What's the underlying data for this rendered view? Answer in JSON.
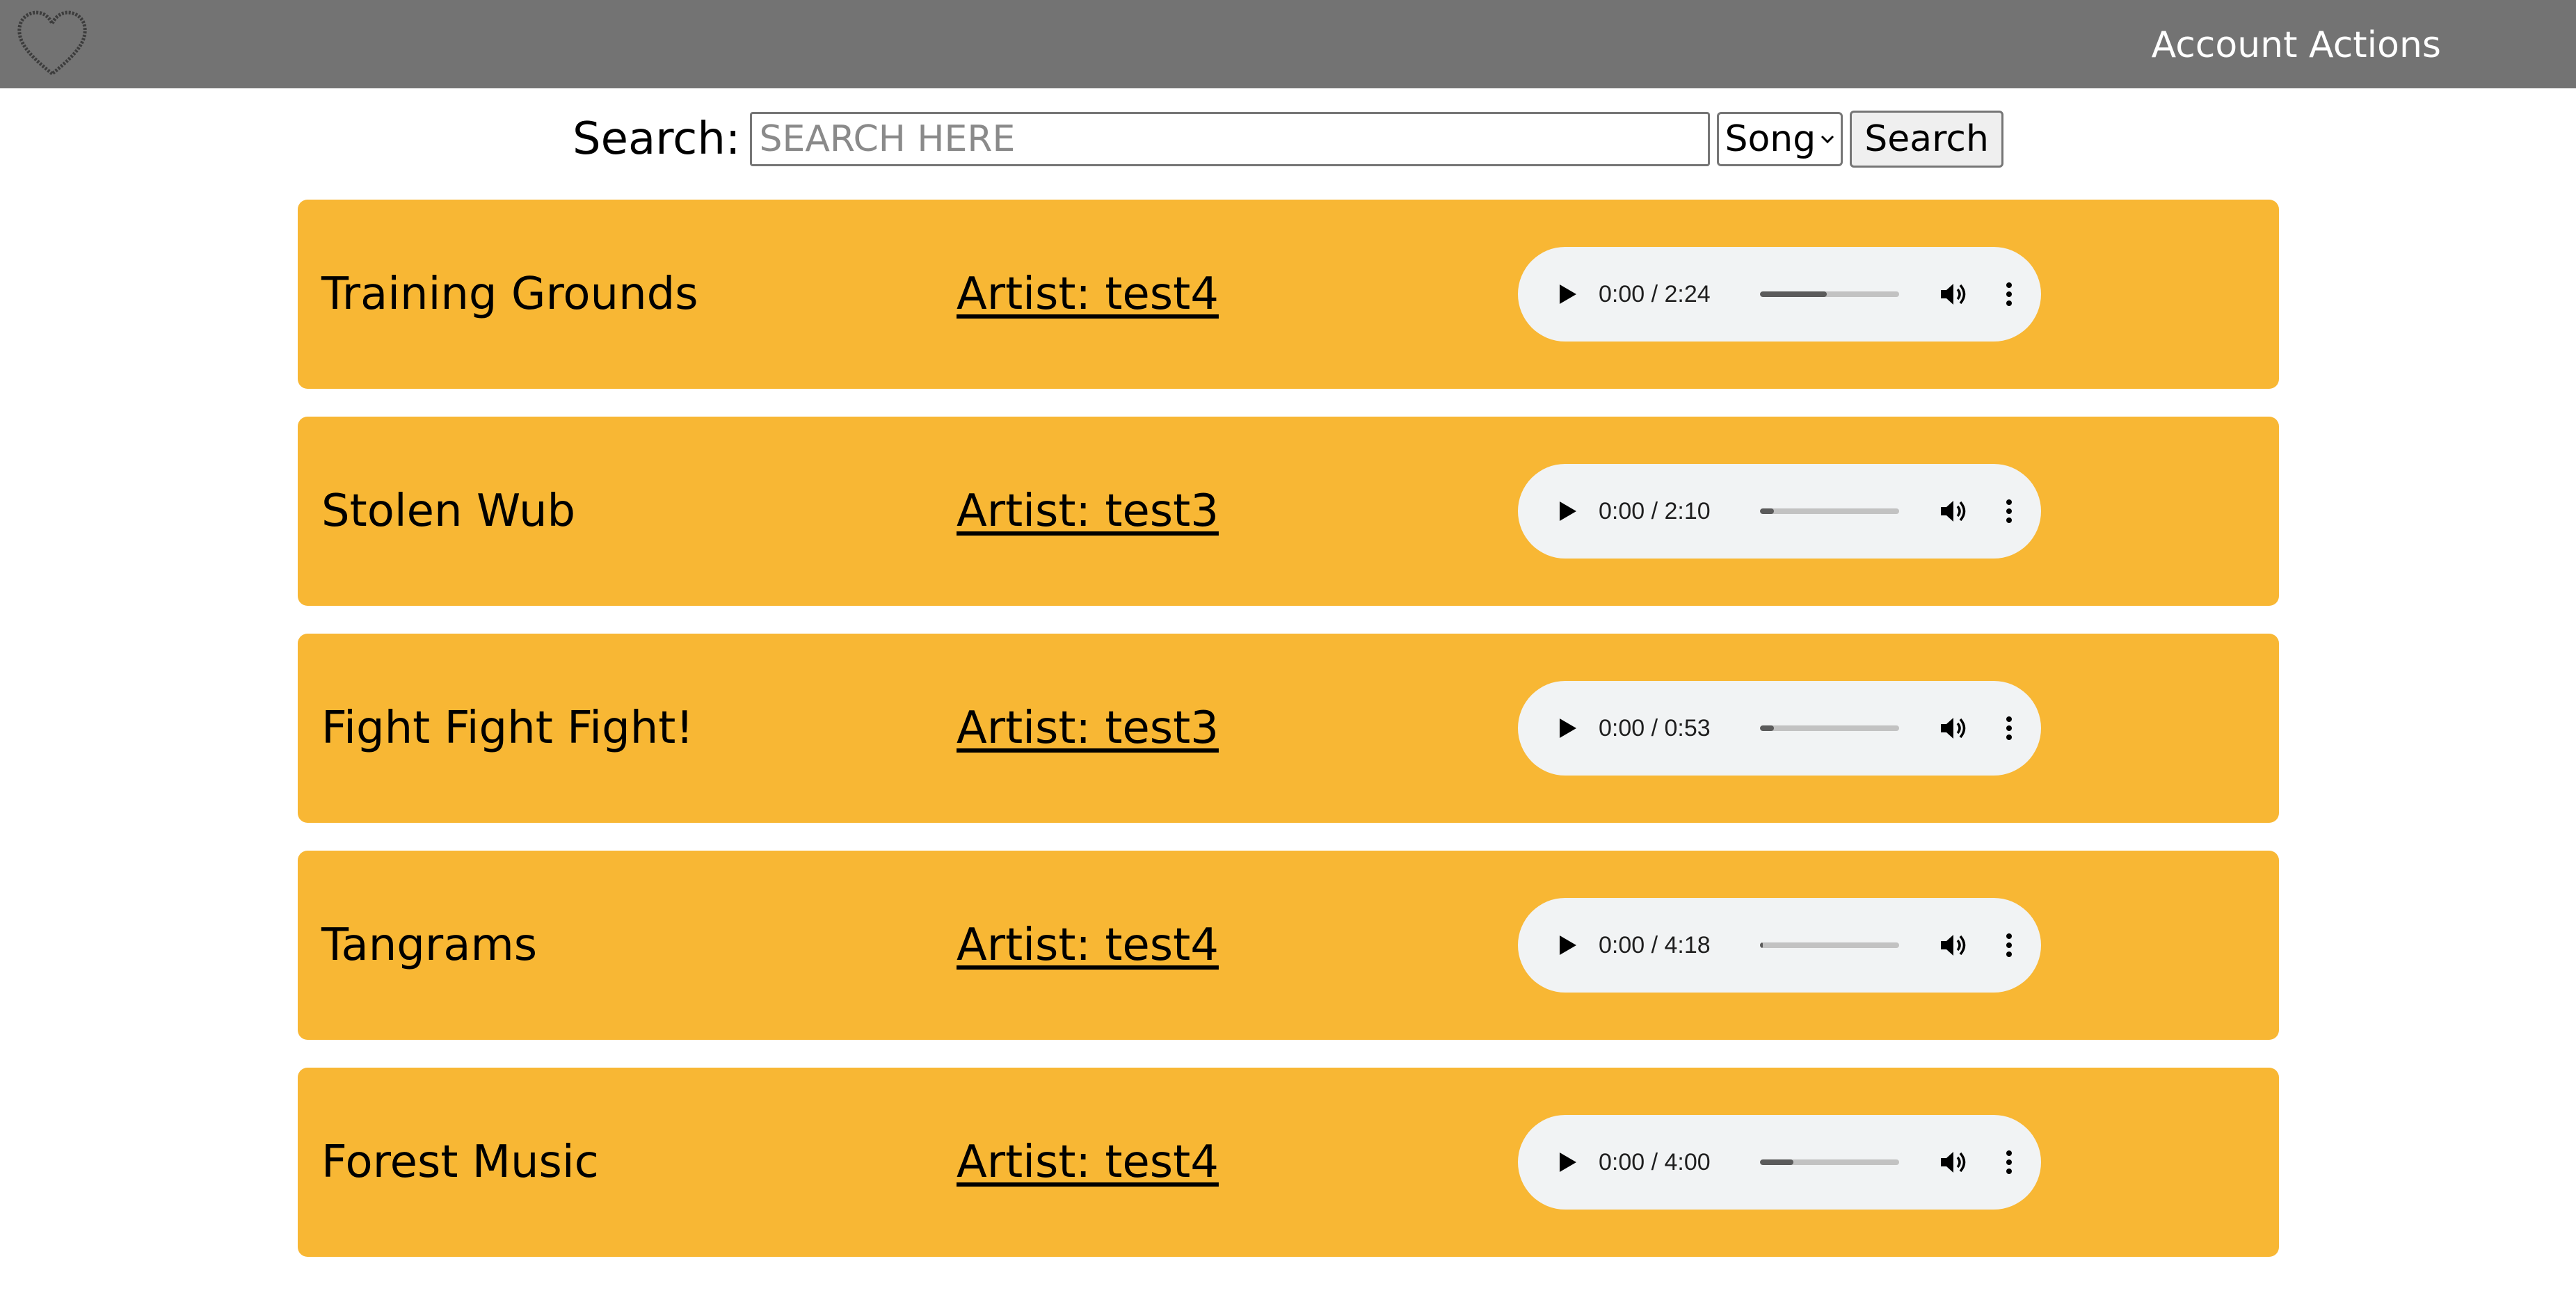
{
  "header": {
    "logo_icon": "heart-outline-icon",
    "account_actions_label": "Account Actions",
    "background_color": "#737373"
  },
  "search": {
    "label": "Search:",
    "placeholder": "SEARCH HERE",
    "value": "",
    "type_selected": "Song",
    "button_label": "Search"
  },
  "accent_color": "#f8b734",
  "songs": [
    {
      "title": "Training Grounds",
      "artist": "Artist: test4",
      "time": "0:00 / 2:24",
      "buffered": 0.48
    },
    {
      "title": "Stolen Wub",
      "artist": "Artist: test3",
      "time": "0:00 / 2:10",
      "buffered": 0.1
    },
    {
      "title": "Fight Fight Fight!",
      "artist": "Artist: test3",
      "time": "0:00 / 0:53",
      "buffered": 0.1
    },
    {
      "title": "Tangrams",
      "artist": "Artist: test4",
      "time": "0:00 / 4:18",
      "buffered": 0.02
    },
    {
      "title": "Forest Music",
      "artist": "Artist: test4",
      "time": "0:00 / 4:00",
      "buffered": 0.24
    }
  ]
}
